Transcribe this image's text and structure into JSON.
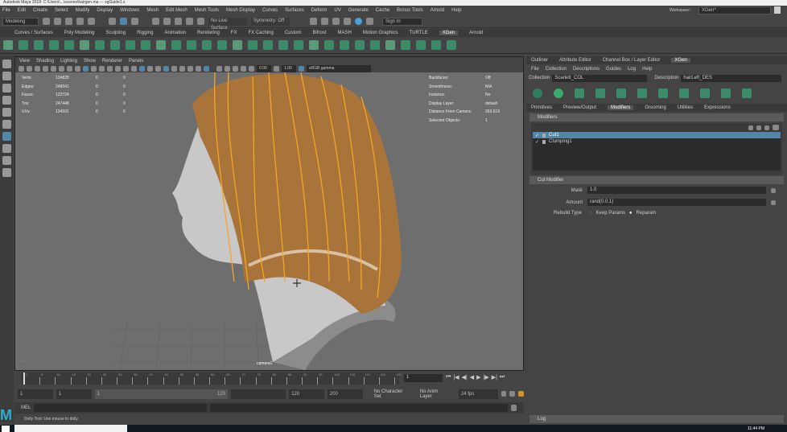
{
  "window": {
    "title": "Autodesk Maya 2018: C:\\Users\\...\\scenes\\hairgen.ma  ---  xgGuide1.x"
  },
  "menubar": [
    "File",
    "Edit",
    "Create",
    "Select",
    "Modify",
    "Display",
    "Windows",
    "Mesh",
    "Edit Mesh",
    "Mesh Tools",
    "Mesh Display",
    "Curves",
    "Surfaces",
    "Deform",
    "UV",
    "Generate",
    "Cache",
    "Bonus Tools",
    "Arnold",
    "Help"
  ],
  "status": {
    "mode": "Modeling",
    "live_surface": "No Live Surface",
    "symmetry": "Symmetry: Off",
    "sign_in": "Sign In",
    "workspace_label": "Workspace :",
    "workspace": "XGen*"
  },
  "shelf_tabs": [
    "Curves / Surfaces",
    "Poly Modeling",
    "Sculpting",
    "Rigging",
    "Animation",
    "Rendering",
    "FX",
    "FX Caching",
    "Custom",
    "Bifrost",
    "MASH",
    "Motion Graphics",
    "TURTLE",
    "XGen",
    "Arnold"
  ],
  "shelf_active": "XGen",
  "viewport": {
    "menu": [
      "View",
      "Shading",
      "Lighting",
      "Show",
      "Renderer",
      "Panels"
    ],
    "exposure": "0.00",
    "gamma": "1.00",
    "color_space": "sRGB gamma",
    "stats": [
      {
        "label": "Verts:",
        "v": "134828",
        "a": "0",
        "b": "0"
      },
      {
        "label": "Edges:",
        "v": "248541",
        "a": "0",
        "b": "0"
      },
      {
        "label": "Faces:",
        "v": "123724",
        "a": "0",
        "b": "0"
      },
      {
        "label": "Tris:",
        "v": "247448",
        "a": "0",
        "b": "0"
      },
      {
        "label": "UVs:",
        "v": "134591",
        "a": "0",
        "b": "0"
      }
    ],
    "info": [
      {
        "label": "Backfaces:",
        "v": "Off"
      },
      {
        "label": "Smoothness:",
        "v": "N/A"
      },
      {
        "label": "Instance:",
        "v": "No"
      },
      {
        "label": "Display Layer:",
        "v": "default"
      },
      {
        "label": "Distance From Camera:",
        "v": "263.619"
      },
      {
        "label": "Selected Objects:",
        "v": "1"
      }
    ],
    "camera": "camera1"
  },
  "right_panel": {
    "tabs": [
      "Outliner",
      "Attribute Editor",
      "Channel Box / Layer Editor",
      "XGen"
    ],
    "active_tab": "XGen",
    "menu": [
      "File",
      "Collection",
      "Descriptions",
      "Guides",
      "Log",
      "Help"
    ],
    "collection_label": "Collection",
    "collection": "Scarlett_COL",
    "description_label": "Description",
    "description": "hairLeft_DES",
    "subtabs": [
      "Primitives",
      "Preview/Output",
      "Modifiers",
      "Grooming",
      "Utilities",
      "Expressions"
    ],
    "active_subtab": "Modifiers",
    "modifiers_header": "Modifiers",
    "modifiers": [
      {
        "name": "Cut1",
        "checked": true,
        "selected": true
      },
      {
        "name": "Clumping1",
        "checked": true,
        "selected": false
      }
    ],
    "cut_header": "Cut Modifier",
    "mask_label": "Mask",
    "mask": "1.0",
    "amount_label": "Amount",
    "amount": "rand(0.0,1)",
    "rebuild_label": "Rebuild Type",
    "rebuild_options": [
      "Keep Params",
      "Reparam"
    ],
    "rebuild_selected": "Reparam",
    "log": "Log"
  },
  "timeline": {
    "ticks": [
      "1",
      "5",
      "10",
      "15",
      "20",
      "25",
      "30",
      "35",
      "40",
      "45",
      "50",
      "55",
      "60",
      "65",
      "70",
      "75",
      "80",
      "85",
      "90",
      "95",
      "100",
      "105",
      "110",
      "115",
      "120"
    ],
    "current": "1"
  },
  "range": {
    "start": "1",
    "start2": "1",
    "slider_start": "1",
    "slider_end": "120",
    "end": "120",
    "end2": "200",
    "character_set": "No Character Set",
    "anim_layer": "No Anim Layer",
    "fps": "24 fps"
  },
  "cmd": {
    "label": "MEL"
  },
  "help_line": "Dolly Tool: Use mouse to dolly",
  "taskbar": {
    "time": "11:44 PM"
  },
  "colors": {
    "accent": "#5285a6",
    "hair": "#a8743a",
    "guides": "#f5a623"
  }
}
